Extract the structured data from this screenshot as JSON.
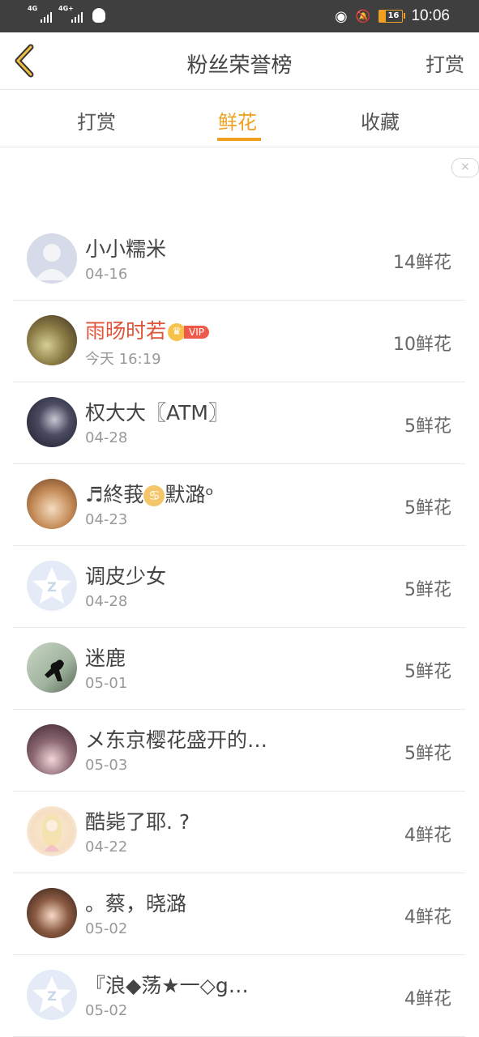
{
  "status_bar": {
    "signal1_label": "4G",
    "signal2_label": "4G+",
    "battery_level": "16",
    "time": "10:06",
    "icons": [
      "signal-icon",
      "signal-icon",
      "qq-penguin-icon",
      "eye-icon",
      "bell-muted-icon",
      "battery-icon"
    ]
  },
  "navbar": {
    "title": "粉丝荣誉榜",
    "right_label": "打赏",
    "back_icon": "chevron-left-icon",
    "accent_color": "#f0a020"
  },
  "tabs": [
    {
      "label": "打赏",
      "active": false
    },
    {
      "label": "鲜花",
      "active": true
    },
    {
      "label": "收藏",
      "active": false
    }
  ],
  "ad_close_symbol": "×",
  "list": [
    {
      "name": "小小糯米",
      "date": "04-16",
      "count": "14鲜花"
    },
    {
      "name": "雨旸时若",
      "date": "今天 16:19",
      "count": "10鲜花",
      "vip": "VIP",
      "crown": "♛"
    },
    {
      "name": "权大大〖ATM〗",
      "date": "04-28",
      "count": "5鲜花"
    },
    {
      "name_prefix": "♬終莪",
      "zodiac": "♋",
      "name_suffix": "默潞ᵒ",
      "date": "04-23",
      "count": "5鲜花"
    },
    {
      "name": "调皮少女",
      "date": "04-28",
      "count": "5鲜花"
    },
    {
      "name": "迷鹿",
      "date": "05-01",
      "count": "5鲜花"
    },
    {
      "name": "メ东京樱花盛开的…",
      "date": "05-03",
      "count": "5鲜花"
    },
    {
      "name": "酷毙了耶. ?",
      "date": "04-22",
      "count": "4鲜花"
    },
    {
      "name": "。蔡，晓潞",
      "date": "05-02",
      "count": "4鲜花"
    },
    {
      "name": "『浪◆荡★一◇g…",
      "date": "05-02",
      "count": "4鲜花"
    }
  ]
}
